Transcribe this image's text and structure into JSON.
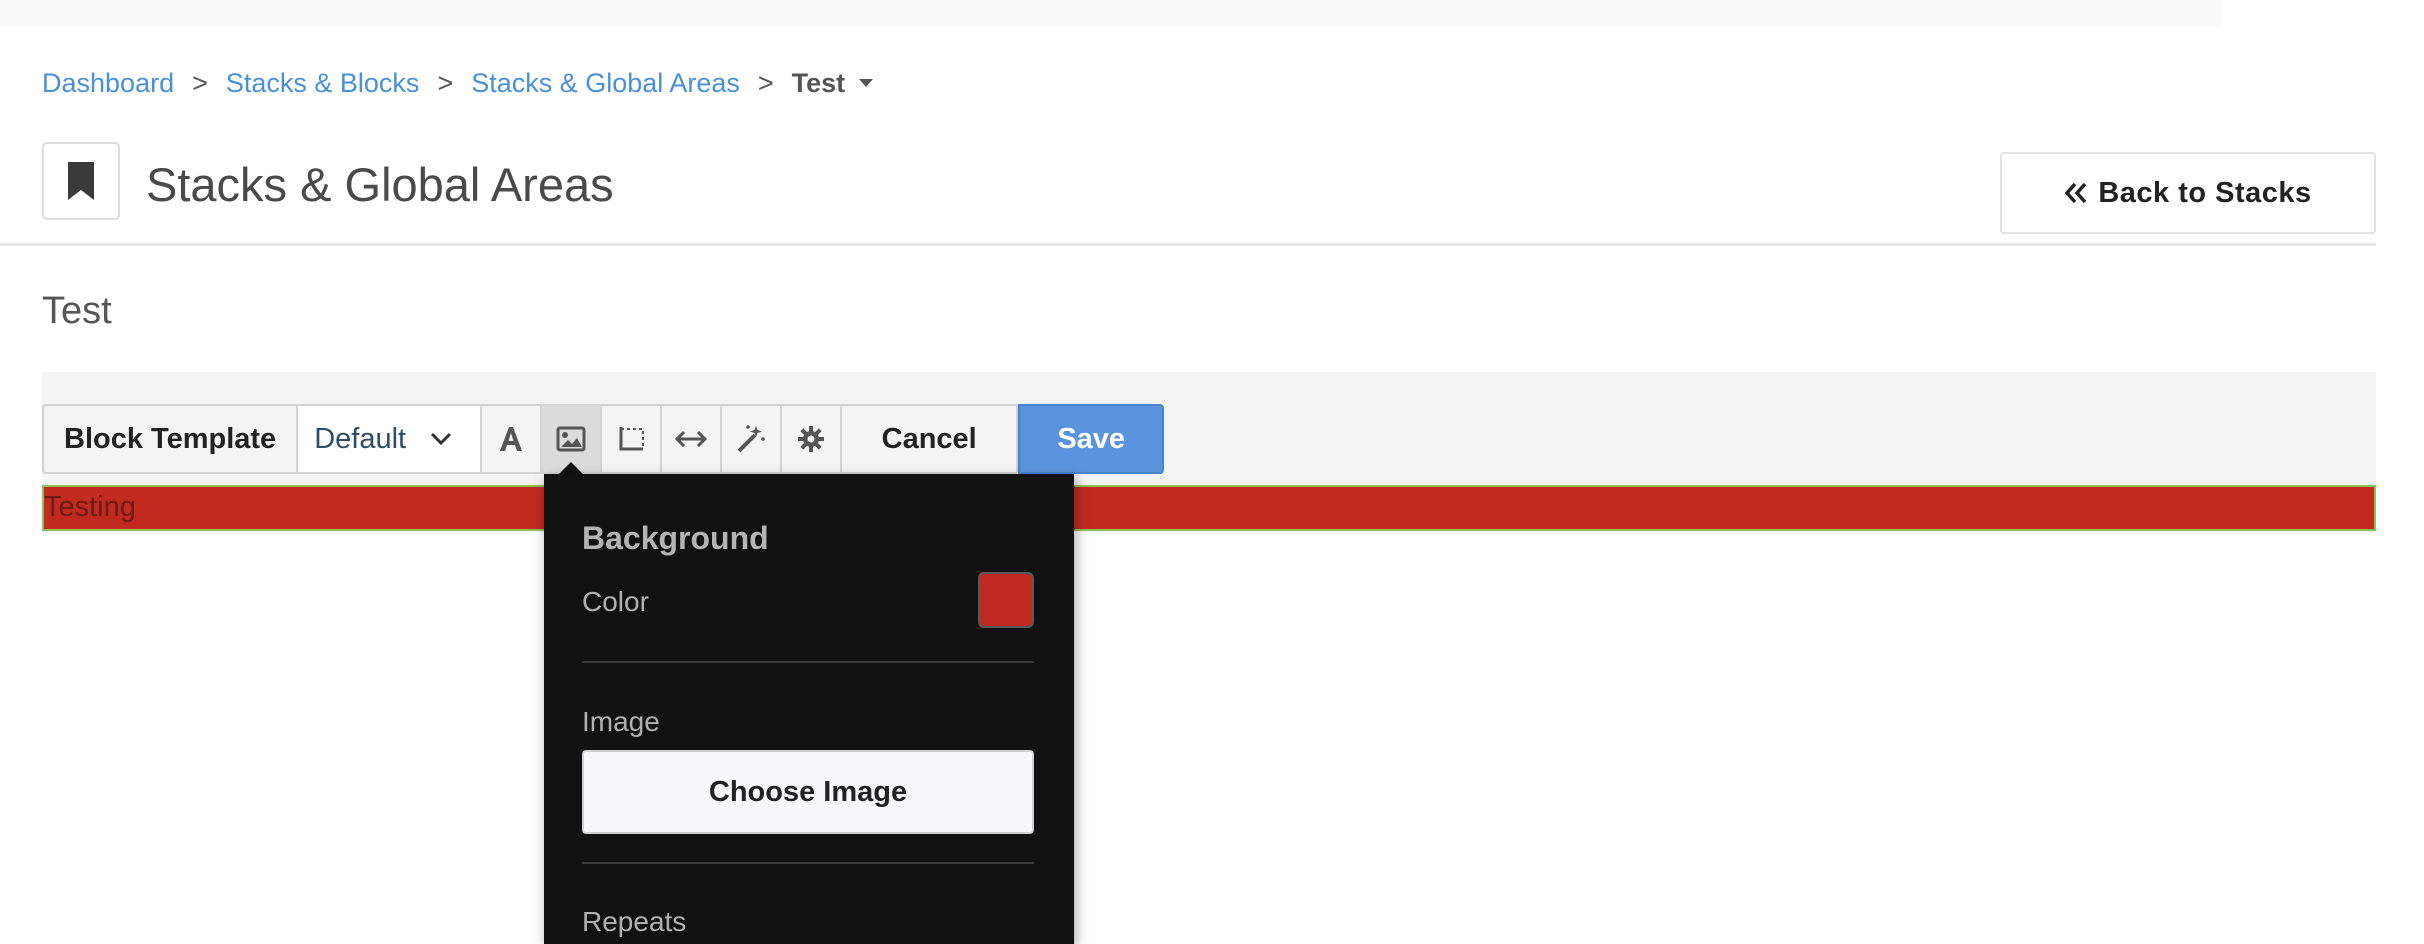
{
  "breadcrumb": {
    "items": [
      "Dashboard",
      "Stacks & Blocks",
      "Stacks & Global Areas"
    ],
    "current": "Test",
    "separator": ">"
  },
  "header": {
    "icon": "bookmark-icon",
    "title": "Stacks & Global Areas",
    "back_button": "Back to Stacks"
  },
  "stack": {
    "name": "Test"
  },
  "toolbar": {
    "template_label": "Block Template",
    "template_value": "Default",
    "icons": [
      "font-icon",
      "image-icon",
      "border-icon",
      "width-icon",
      "magic-wand-icon",
      "gear-icon"
    ],
    "active_icon": "image-icon",
    "cancel_label": "Cancel",
    "save_label": "Save"
  },
  "block": {
    "text": "Testing",
    "background_color": "#c22a20"
  },
  "popover": {
    "heading": "Background",
    "color_label": "Color",
    "color_value": "#c0291f",
    "image_label": "Image",
    "choose_image_label": "Choose Image",
    "repeats_label": "Repeats"
  },
  "colors": {
    "link": "#4a90d9",
    "save": "#5a94dc",
    "popover_bg": "#111111"
  }
}
